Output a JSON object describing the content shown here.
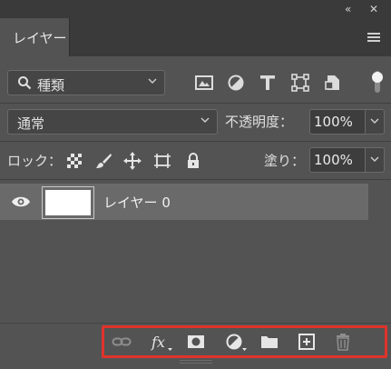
{
  "window": {
    "collapse_glyph": "«",
    "close_glyph": "✕"
  },
  "tab": {
    "label": "レイヤー"
  },
  "filter": {
    "kind_label": "種類",
    "icons": [
      "image-filter-icon",
      "adjustment-filter-icon",
      "type-filter-icon",
      "shape-filter-icon",
      "smart-object-filter-icon",
      "filter-toggle-icon"
    ]
  },
  "blend": {
    "mode": "通常",
    "opacity_label": "不透明度：",
    "opacity_value": "100%"
  },
  "lock": {
    "label": "ロック：",
    "icons": [
      "lock-transparent-pixels-icon",
      "lock-image-pixels-icon",
      "lock-position-icon",
      "lock-artboard-icon",
      "lock-all-icon"
    ],
    "fill_label": "塗り：",
    "fill_value": "100%"
  },
  "layers": [
    {
      "name": "レイヤー 0",
      "visible": true,
      "thumbnail_color": "#ffffff"
    }
  ],
  "footer": {
    "icons": [
      "link-layers-icon",
      "fx-icon",
      "add-mask-icon",
      "new-adjustment-layer-icon",
      "new-group-icon",
      "new-layer-icon",
      "delete-layer-icon"
    ],
    "highlight_color": "#e0332c"
  }
}
